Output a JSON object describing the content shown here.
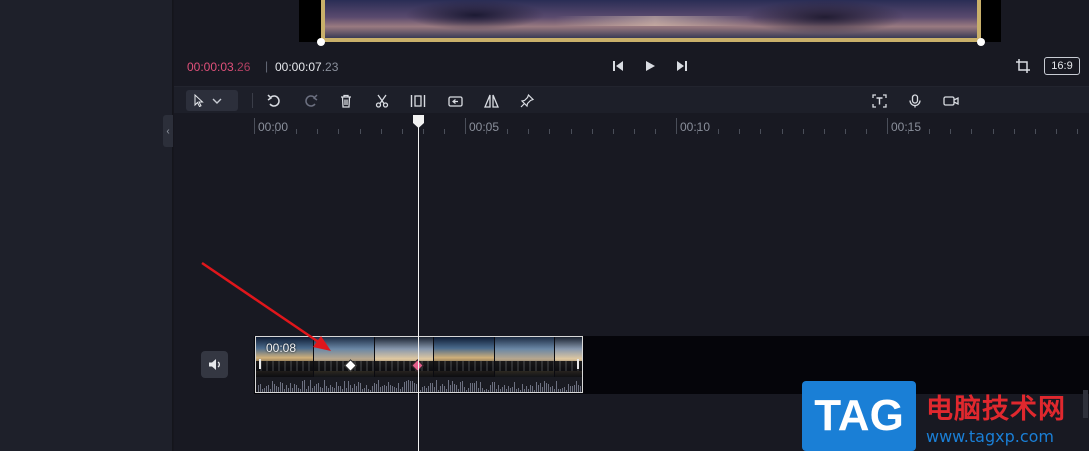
{
  "preview": {
    "current_time": "00:00:03",
    "current_frames": ".26",
    "separator": "|",
    "total_time": "00:00:07",
    "total_frames": ".23",
    "aspect_ratio": "16:9"
  },
  "toolbar": {
    "select_tool_icon": "pointer-icon",
    "tools": [
      "undo-icon",
      "redo-icon",
      "delete-icon",
      "split-icon",
      "freeze-icon",
      "rotate-icon",
      "mirror-icon",
      "pin-icon"
    ],
    "right_tools": [
      "text-recognize-icon",
      "microphone-icon",
      "camera-icon"
    ]
  },
  "ruler": {
    "labels": [
      "00:00",
      "00:05",
      "00:10",
      "00:15"
    ]
  },
  "clip": {
    "duration": "00:08"
  },
  "watermark": {
    "logo_text": "TAG",
    "title": "电脑技术网",
    "url": "www.tagxp.com"
  },
  "colors": {
    "accent_time": "#e0507a",
    "keyframe_pink": "#e35d8a",
    "arrow": "#e0161b",
    "watermark_blue": "#1a7fd6",
    "watermark_red": "#e0282e"
  }
}
